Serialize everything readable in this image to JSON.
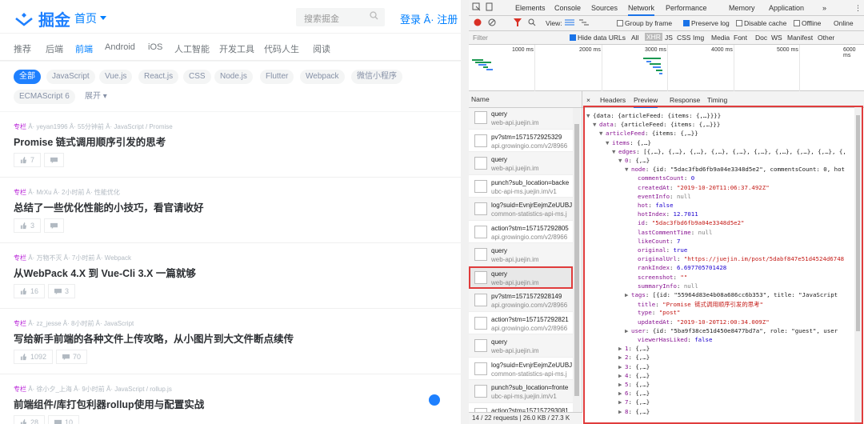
{
  "site": {
    "logo_text": "掘金",
    "home_label": "首页",
    "search_placeholder": "搜索掘金",
    "auth_label": "登录 Â· 注册",
    "categories": [
      "推荐",
      "后端",
      "前端",
      "Android",
      "iOS",
      "人工智能",
      "开发工具",
      "代码人生",
      "阅读"
    ],
    "active_category": "前端",
    "tags": [
      "全部",
      "JavaScript",
      "Vue.js",
      "React.js",
      "CSS",
      "Node.js",
      "Flutter",
      "Webpack",
      "微信小程序",
      "ECMAScript 6",
      "展开"
    ],
    "articles": [
      {
        "tag": "专栏",
        "meta": " Â· yeyan1996 Â· 55分钟前 Â· JavaScript / Promise",
        "title": "Promise 链式调用顺序引发的思考",
        "likes": "7",
        "comments": ""
      },
      {
        "tag": "专栏",
        "meta": " Â· MrXu Â· 2小时前 Â· 性能优化",
        "title": "总结了一些优化性能的小技巧，看官请收好",
        "likes": "3",
        "comments": ""
      },
      {
        "tag": "专栏",
        "meta": " Â· 万物不灭 Â· 7小时前 Â· Webpack",
        "title": "从WebPack 4.X 到 Vue-Cli 3.X 一篇就够",
        "likes": "16",
        "comments": "3"
      },
      {
        "tag": "专栏",
        "meta": " Â· zz_jesse Â· 8小时前 Â· JavaScript",
        "title": "写给新手前端的各种文件上传攻略，从小图片到大文件断点续传",
        "likes": "1092",
        "comments": "70"
      },
      {
        "tag": "专栏",
        "meta": " Â· 徐小夕_上海 Â· 9小时前 Â· JavaScript / rollup.js",
        "title": "前端组件/库打包利器rollup使用与配置实战",
        "likes": "28",
        "comments": "10"
      }
    ]
  },
  "devtools": {
    "tabs": [
      "Elements",
      "Console",
      "Sources",
      "Network",
      "Performance",
      "Memory",
      "Application",
      "»"
    ],
    "active_tab": "Network",
    "toolbar": {
      "view": "View:",
      "group_by_frame": "Group by frame",
      "preserve_log": "Preserve log",
      "disable_cache": "Disable cache",
      "offline": "Offline",
      "online": "Online"
    },
    "filter": {
      "placeholder": "Filter",
      "hide_data_urls": "Hide data URLs",
      "types": [
        "All",
        "XHR",
        "JS",
        "CSS",
        "Img",
        "Media",
        "Font",
        "Doc",
        "WS",
        "Manifest",
        "Other"
      ],
      "active_type": "XHR"
    },
    "timeline_ticks": [
      "1000 ms",
      "2000 ms",
      "3000 ms",
      "4000 ms",
      "5000 ms",
      "6000 ms"
    ],
    "name_header": "Name",
    "requests": [
      {
        "name": "query",
        "domain": "web-api.juejin.im"
      },
      {
        "name": "pv?stm=1571572925329",
        "domain": "api.growingio.com/v2/8966"
      },
      {
        "name": "query",
        "domain": "web-api.juejin.im"
      },
      {
        "name": "punch?sub_location=backe",
        "domain": "ubc-api-ms.juejin.im/v1"
      },
      {
        "name": "log?suid=EvnjrEejmZeUUBJ",
        "domain": "common-statistics-api-ms.j"
      },
      {
        "name": "action?stm=157157292805",
        "domain": "api.growingio.com/v2/8966"
      },
      {
        "name": "query",
        "domain": "web-api.juejin.im"
      },
      {
        "name": "query",
        "domain": "web-api.juejin.im",
        "highlight": true
      },
      {
        "name": "pv?stm=1571572928149",
        "domain": "api.growingio.com/v2/8966"
      },
      {
        "name": "action?stm=157157292821",
        "domain": "api.growingio.com/v2/8966"
      },
      {
        "name": "query",
        "domain": "web-api.juejin.im"
      },
      {
        "name": "log?suid=EvnjrEejmZeUUBJ",
        "domain": "common-statistics-api-ms.j"
      },
      {
        "name": "punch?sub_location=fronte",
        "domain": "ubc-api-ms.juejin.im/v1"
      },
      {
        "name": "action?stm=157157293081",
        "domain": "api.growingio.com/v2/8966"
      }
    ],
    "status": "14 / 22 requests | 26.0 KB / 27.3 K",
    "preview_tabs": [
      "×",
      "Headers",
      "Preview",
      "Response",
      "Timing"
    ],
    "active_preview_tab": "Preview",
    "json_lines": [
      {
        "tri": "▼",
        "t": "{data: {articleFeed: {items: {,…}}}}"
      },
      {
        "tri": "▼",
        "k": "data",
        "t": "{articleFeed: {items: {,…}}}"
      },
      {
        "tri": "▼",
        "k": "articleFeed",
        "t": "{items: {,…}}"
      },
      {
        "tri": "▼",
        "k": "items",
        "t": "{,…}"
      },
      {
        "tri": "▼",
        "k": "edges",
        "t": "[{,…}, {,…}, {,…}, {,…}, {,…}, {,…}, {,…}, {,…}, {,…}, {,"
      },
      {
        "tri": "▼",
        "k": "0",
        "t": "{,…}"
      },
      {
        "tri": "▼",
        "k": "node",
        "t": "{id: \"5dac3fbd6fb9a04e3348d5e2\", commentsCount: 0, hot"
      },
      {
        "k": "commentsCount",
        "v": "0",
        "c": "n"
      },
      {
        "k": "createdAt",
        "v": "\"2019-10-20T11:06:37.492Z\"",
        "c": "s"
      },
      {
        "k": "eventInfo",
        "v": "null",
        "c": "g"
      },
      {
        "k": "hot",
        "v": "false",
        "c": "n"
      },
      {
        "k": "hotIndex",
        "v": "12.7011",
        "c": "n"
      },
      {
        "k": "id",
        "v": "\"5dac3fbd6fb9a04e3348d5e2\"",
        "c": "s"
      },
      {
        "k": "lastCommentTime",
        "v": "null",
        "c": "g"
      },
      {
        "k": "likeCount",
        "v": "7",
        "c": "n"
      },
      {
        "k": "original",
        "v": "true",
        "c": "n"
      },
      {
        "k": "originalUrl",
        "v": "\"https://juejin.im/post/5dabf847e51d4524d6748",
        "c": "s"
      },
      {
        "k": "rankIndex",
        "v": "6.697705701428",
        "c": "n"
      },
      {
        "k": "screenshot",
        "v": "\"\"",
        "c": "s"
      },
      {
        "k": "summaryInfo",
        "v": "null",
        "c": "g"
      },
      {
        "tri": "▶",
        "k": "tags",
        "t": "[{id: \"55964d83e4b08a686cc6b353\", title: \"JavaScript"
      },
      {
        "k": "title",
        "v": "\"Promise 链式调用顺序引发的思考\"",
        "c": "s"
      },
      {
        "k": "type",
        "v": "\"post\"",
        "c": "s"
      },
      {
        "k": "updatedAt",
        "v": "\"2019-10-20T12:00:34.009Z\"",
        "c": "s"
      },
      {
        "tri": "▶",
        "k": "user",
        "t": "{id: \"5ba9f38ce51d450e8477bd7a\", role: \"guest\", user"
      },
      {
        "k": "viewerHasLiked",
        "v": "false",
        "c": "n"
      },
      {
        "tri": "▶",
        "k": "1",
        "t": "{,…}"
      },
      {
        "tri": "▶",
        "k": "2",
        "t": "{,…}"
      },
      {
        "tri": "▶",
        "k": "3",
        "t": "{,…}"
      },
      {
        "tri": "▶",
        "k": "4",
        "t": "{,…}"
      },
      {
        "tri": "▶",
        "k": "5",
        "t": "{,…}"
      },
      {
        "tri": "▶",
        "k": "6",
        "t": "{,…}"
      },
      {
        "tri": "▶",
        "k": "7",
        "t": "{,…}"
      },
      {
        "tri": "▶",
        "k": "8",
        "t": "{,…}"
      }
    ]
  }
}
